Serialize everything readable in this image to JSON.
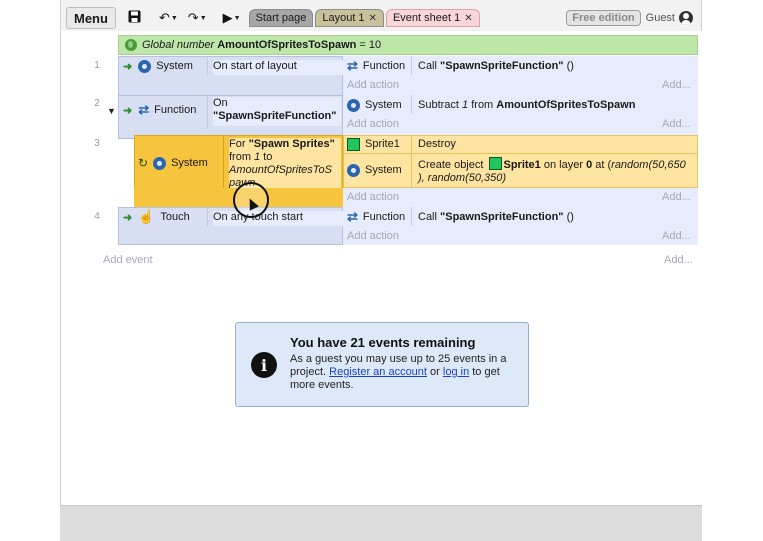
{
  "toolbar": {
    "menu_label": "Menu",
    "save_icon": "save-icon",
    "undo_icon": "undo-icon",
    "redo_icon": "redo-icon",
    "play_icon": "play-icon",
    "tabs": [
      {
        "label": "Start page"
      },
      {
        "label": "Layout 1"
      },
      {
        "label": "Event sheet 1"
      }
    ],
    "free_edition": "Free edition",
    "guest": "Guest"
  },
  "global_var": {
    "prefix": "Global number",
    "name": "AmountOfSpritesToSpawn",
    "suffix": "= 10"
  },
  "events": [
    {
      "num": "1",
      "cond_object": "System",
      "cond_text": "On start of layout",
      "actions": [
        {
          "object": "Function",
          "text_prefix": "Call",
          "text_bold": "\"SpawnSpriteFunction\"",
          "text_suffix": "()"
        }
      ]
    },
    {
      "num": "2",
      "cond_object": "Function",
      "cond_line1": "On",
      "cond_line2": "\"SpawnSpriteFunction\"",
      "actions": [
        {
          "object": "System",
          "text_prefix": "Subtract",
          "text_italic": "1",
          "text_mid": "from",
          "text_bold": "AmountOfSpritesToSpawn"
        }
      ]
    },
    {
      "num": "3",
      "cond_object": "System",
      "cond_for": "For",
      "cond_name": "\"Spawn Sprites\"",
      "cond_from": "from",
      "cond_from_val": "1",
      "cond_to": "to",
      "cond_to_val_1": "AmountOfSpritesToS",
      "cond_to_val_2": "pawn",
      "actions": [
        {
          "object": "Sprite1",
          "text": "Destroy"
        },
        {
          "object": "System",
          "text_prefix": "Create object",
          "obj_name": "Sprite1",
          "layer_text": "on layer",
          "layer_val": "0",
          "at_text": "at (",
          "expr1": "random(50,650",
          "expr2": "), random(50,350)",
          "close": ")"
        }
      ]
    },
    {
      "num": "4",
      "cond_object": "Touch",
      "cond_text": "On any touch start",
      "actions": [
        {
          "object": "Function",
          "text_prefix": "Call",
          "text_bold": "\"SpawnSpriteFunction\"",
          "text_suffix": "()"
        }
      ]
    }
  ],
  "add_action": "Add action",
  "add_right": "Add...",
  "add_event": "Add event",
  "notice": {
    "title": "You have 21 events remaining",
    "body_1": "As a guest you may use up to 25 events in a project.",
    "link_register": "Register an account",
    "or": "or",
    "link_login": "log in",
    "body_2": "to get more events."
  },
  "colors": {
    "global_var_bg": "#bde6a8",
    "condition_bg": "#d9dff3",
    "action_bg": "#e6ecfb",
    "selected_condition_bg": "#f7c43d",
    "selected_action_bg": "#fde4a0",
    "notice_bg": "#dde9f9",
    "sprite_green": "#22c55e",
    "link": "#1a43c9"
  }
}
